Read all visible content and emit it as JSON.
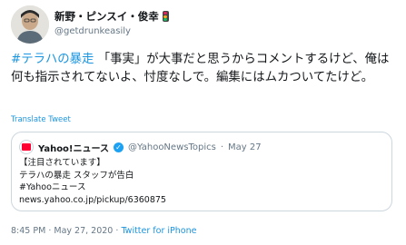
{
  "author": {
    "name": "新野・ピンスイ・俊幸",
    "handle": "@getdrunkeasily",
    "name_icon": "traffic-light-icon"
  },
  "tweet": {
    "hashtag": "#テラハの暴走",
    "text": " 「事実」が大事だと思うからコメントするけど、俺は何も指示されてないよ、忖度なしで。編集にはムカついてたけど。",
    "translate_label": "Translate Tweet"
  },
  "quote": {
    "name": "Yahoo!ニュース",
    "handle": "@YahooNewsTopics",
    "separator": "·",
    "date": "May 27",
    "lines": [
      "【注目されています】",
      "テラハの暴走 スタッフが告白",
      "#Yahooニュース",
      "news.yahoo.co.jp/pickup/6360875"
    ],
    "verified_icon": "verified-badge-icon",
    "avatar_color": "#ff0033"
  },
  "meta": {
    "time": "8:45 PM",
    "separator": "·",
    "date": "May 27, 2020",
    "client": "Twitter for iPhone"
  },
  "colors": {
    "link": "#1b95e0",
    "secondary_text": "#657786",
    "border": "#ccd6dd"
  }
}
